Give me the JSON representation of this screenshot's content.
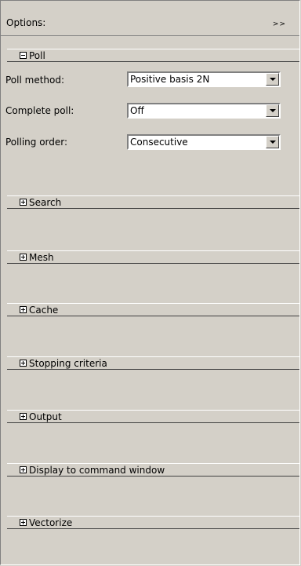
{
  "header": {
    "title": "Options:",
    "expand_label": ">>"
  },
  "poll": {
    "label": "Poll",
    "rows": [
      {
        "label": "Poll method:",
        "value": "Positive basis 2N"
      },
      {
        "label": "Complete poll:",
        "value": "Off"
      },
      {
        "label": "Polling order:",
        "value": "Consecutive"
      }
    ]
  },
  "sections": [
    {
      "label": "Search"
    },
    {
      "label": "Mesh"
    },
    {
      "label": "Cache"
    },
    {
      "label": "Stopping criteria"
    },
    {
      "label": "Output"
    },
    {
      "label": "Display to command window"
    },
    {
      "label": "Vectorize"
    }
  ]
}
